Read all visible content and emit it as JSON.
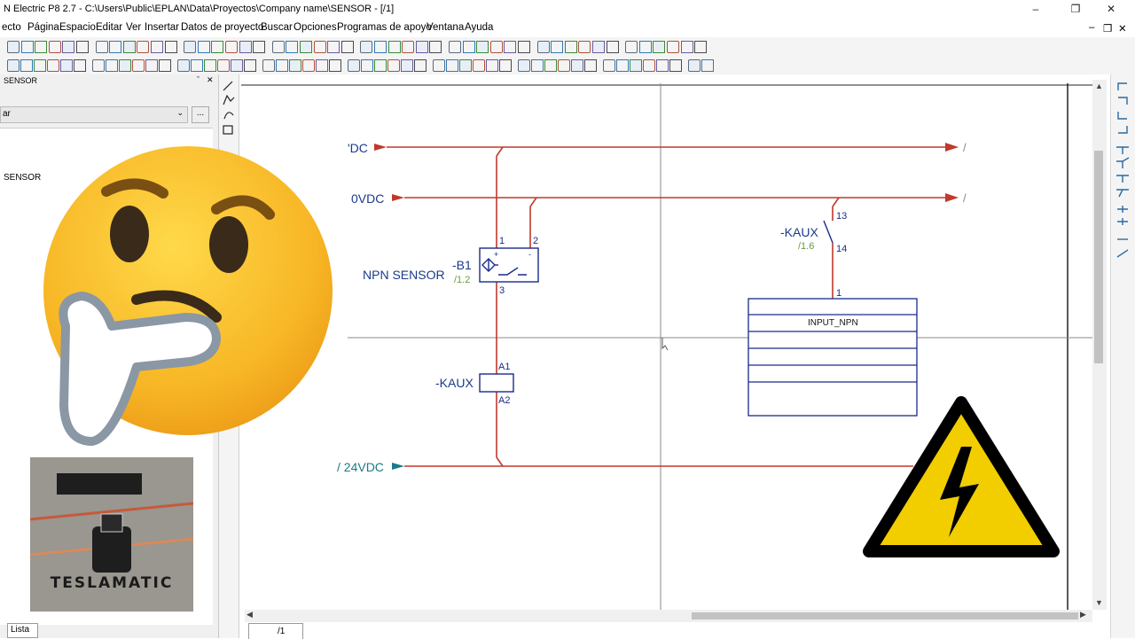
{
  "window": {
    "title": "N Electric P8 2.7 - C:\\Users\\Public\\EPLAN\\Data\\Proyectos\\Company name\\SENSOR - [/1]",
    "minimize": "–",
    "maximize": "❐",
    "close": "✕"
  },
  "menu": {
    "items": [
      "ecto",
      "Página",
      "Espacio",
      "Editar",
      "Ver",
      "Insertar",
      "Datos de proyecto",
      "Buscar",
      "Opciones",
      "Programas de apoyo",
      "Ventana",
      "Ayuda"
    ],
    "mdi_min": "–",
    "mdi_restore": "❐",
    "mdi_close": "✕"
  },
  "panel": {
    "title": "SENSOR",
    "filter_value": "ar",
    "more_button": "...",
    "tree_item": "SENSOR",
    "tab_label": "Lista"
  },
  "page_tab": "/1",
  "schematic": {
    "wire_color": "#c0392b",
    "label_color": "#1a3a8c",
    "line_color": "#1a2a8c",
    "ref_color": "#6a9a3a",
    "top_rail_label": "'DC",
    "rail_0vdc_label": "0VDC",
    "rail_24vdc_label": "/ 24VDC",
    "rail_arrow_end": "/",
    "sensor_name": "NPN SENSOR",
    "sensor_tag": "-B1",
    "sensor_ref": "/1.2",
    "sensor_pin1": "1",
    "sensor_pin2": "2",
    "sensor_pin3": "3",
    "sensor_plus": "+",
    "sensor_minus": "-",
    "coil_tag": "-KAUX",
    "coil_pin_a1": "A1",
    "coil_pin_a2": "A2",
    "contact_tag": "-KAUX",
    "contact_ref": "/1.6",
    "contact_pin13": "13",
    "contact_pin14": "14",
    "plc_pin": "1",
    "plc_input_label": "INPUT_NPN"
  },
  "logo": {
    "text": "TESLAMATIC"
  }
}
